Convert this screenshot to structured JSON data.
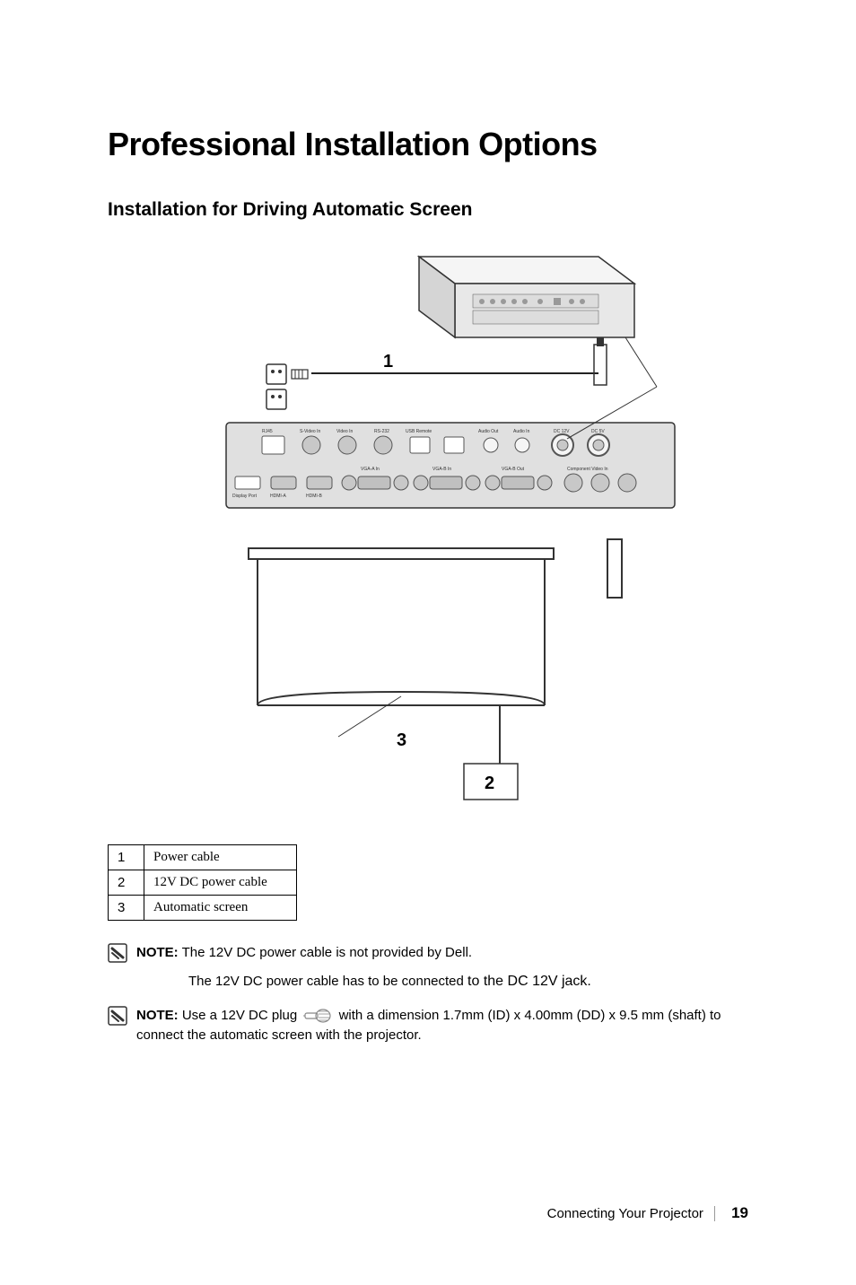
{
  "title": "Professional Installation Options",
  "subtitle": "Installation for Driving Automatic Screen",
  "callouts": {
    "c1": "1",
    "c2": "2",
    "c3": "3"
  },
  "table": {
    "rows": [
      {
        "num": "1",
        "label": "Power cable"
      },
      {
        "num": "2",
        "label": "12V DC power cable"
      },
      {
        "num": "3",
        "label": "Automatic screen"
      }
    ]
  },
  "notes": {
    "note1_prefix": "NOTE:",
    "note1_text": " The 12V DC power cable is not provided by Dell.",
    "note1_sub": "The 12V DC power cable has to be connected ",
    "note1_sub_jack": "to the DC 12V jack.",
    "note2_prefix": "NOTE:",
    "note2_text_a": " Use a 12V DC plug ",
    "note2_text_b": " with a dimension 1.7mm (ID) x 4.00mm (DD) x 9.5 mm (shaft) to connect the automatic screen with the projector."
  },
  "footer": {
    "text": "Connecting Your Projector",
    "page": "19"
  }
}
